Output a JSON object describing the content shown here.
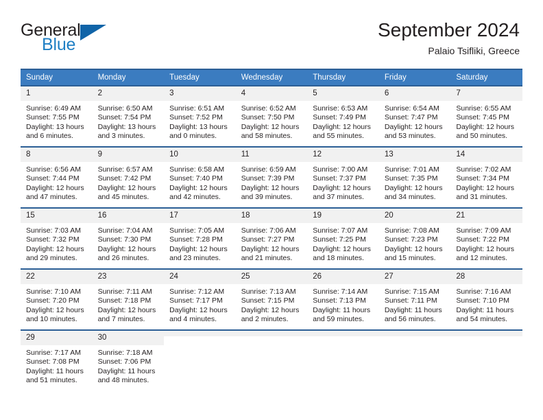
{
  "brand": {
    "word_one": "General",
    "word_two": "Blue",
    "logo_icon": "triangle-logo-icon"
  },
  "header": {
    "title": "September 2024",
    "subtitle": "Palaio Tsifliki, Greece"
  },
  "calendar": {
    "weekdays": [
      "Sunday",
      "Monday",
      "Tuesday",
      "Wednesday",
      "Thursday",
      "Friday",
      "Saturday"
    ],
    "accent_header_color": "#3b7cc0",
    "accent_border_color": "#2c5f96",
    "daynum_background": "#f1f1f1",
    "weeks": [
      [
        {
          "day": "1",
          "sunrise": "Sunrise: 6:49 AM",
          "sunset": "Sunset: 7:55 PM",
          "daylight": "Daylight: 13 hours and 6 minutes."
        },
        {
          "day": "2",
          "sunrise": "Sunrise: 6:50 AM",
          "sunset": "Sunset: 7:54 PM",
          "daylight": "Daylight: 13 hours and 3 minutes."
        },
        {
          "day": "3",
          "sunrise": "Sunrise: 6:51 AM",
          "sunset": "Sunset: 7:52 PM",
          "daylight": "Daylight: 13 hours and 0 minutes."
        },
        {
          "day": "4",
          "sunrise": "Sunrise: 6:52 AM",
          "sunset": "Sunset: 7:50 PM",
          "daylight": "Daylight: 12 hours and 58 minutes."
        },
        {
          "day": "5",
          "sunrise": "Sunrise: 6:53 AM",
          "sunset": "Sunset: 7:49 PM",
          "daylight": "Daylight: 12 hours and 55 minutes."
        },
        {
          "day": "6",
          "sunrise": "Sunrise: 6:54 AM",
          "sunset": "Sunset: 7:47 PM",
          "daylight": "Daylight: 12 hours and 53 minutes."
        },
        {
          "day": "7",
          "sunrise": "Sunrise: 6:55 AM",
          "sunset": "Sunset: 7:45 PM",
          "daylight": "Daylight: 12 hours and 50 minutes."
        }
      ],
      [
        {
          "day": "8",
          "sunrise": "Sunrise: 6:56 AM",
          "sunset": "Sunset: 7:44 PM",
          "daylight": "Daylight: 12 hours and 47 minutes."
        },
        {
          "day": "9",
          "sunrise": "Sunrise: 6:57 AM",
          "sunset": "Sunset: 7:42 PM",
          "daylight": "Daylight: 12 hours and 45 minutes."
        },
        {
          "day": "10",
          "sunrise": "Sunrise: 6:58 AM",
          "sunset": "Sunset: 7:40 PM",
          "daylight": "Daylight: 12 hours and 42 minutes."
        },
        {
          "day": "11",
          "sunrise": "Sunrise: 6:59 AM",
          "sunset": "Sunset: 7:39 PM",
          "daylight": "Daylight: 12 hours and 39 minutes."
        },
        {
          "day": "12",
          "sunrise": "Sunrise: 7:00 AM",
          "sunset": "Sunset: 7:37 PM",
          "daylight": "Daylight: 12 hours and 37 minutes."
        },
        {
          "day": "13",
          "sunrise": "Sunrise: 7:01 AM",
          "sunset": "Sunset: 7:35 PM",
          "daylight": "Daylight: 12 hours and 34 minutes."
        },
        {
          "day": "14",
          "sunrise": "Sunrise: 7:02 AM",
          "sunset": "Sunset: 7:34 PM",
          "daylight": "Daylight: 12 hours and 31 minutes."
        }
      ],
      [
        {
          "day": "15",
          "sunrise": "Sunrise: 7:03 AM",
          "sunset": "Sunset: 7:32 PM",
          "daylight": "Daylight: 12 hours and 29 minutes."
        },
        {
          "day": "16",
          "sunrise": "Sunrise: 7:04 AM",
          "sunset": "Sunset: 7:30 PM",
          "daylight": "Daylight: 12 hours and 26 minutes."
        },
        {
          "day": "17",
          "sunrise": "Sunrise: 7:05 AM",
          "sunset": "Sunset: 7:28 PM",
          "daylight": "Daylight: 12 hours and 23 minutes."
        },
        {
          "day": "18",
          "sunrise": "Sunrise: 7:06 AM",
          "sunset": "Sunset: 7:27 PM",
          "daylight": "Daylight: 12 hours and 21 minutes."
        },
        {
          "day": "19",
          "sunrise": "Sunrise: 7:07 AM",
          "sunset": "Sunset: 7:25 PM",
          "daylight": "Daylight: 12 hours and 18 minutes."
        },
        {
          "day": "20",
          "sunrise": "Sunrise: 7:08 AM",
          "sunset": "Sunset: 7:23 PM",
          "daylight": "Daylight: 12 hours and 15 minutes."
        },
        {
          "day": "21",
          "sunrise": "Sunrise: 7:09 AM",
          "sunset": "Sunset: 7:22 PM",
          "daylight": "Daylight: 12 hours and 12 minutes."
        }
      ],
      [
        {
          "day": "22",
          "sunrise": "Sunrise: 7:10 AM",
          "sunset": "Sunset: 7:20 PM",
          "daylight": "Daylight: 12 hours and 10 minutes."
        },
        {
          "day": "23",
          "sunrise": "Sunrise: 7:11 AM",
          "sunset": "Sunset: 7:18 PM",
          "daylight": "Daylight: 12 hours and 7 minutes."
        },
        {
          "day": "24",
          "sunrise": "Sunrise: 7:12 AM",
          "sunset": "Sunset: 7:17 PM",
          "daylight": "Daylight: 12 hours and 4 minutes."
        },
        {
          "day": "25",
          "sunrise": "Sunrise: 7:13 AM",
          "sunset": "Sunset: 7:15 PM",
          "daylight": "Daylight: 12 hours and 2 minutes."
        },
        {
          "day": "26",
          "sunrise": "Sunrise: 7:14 AM",
          "sunset": "Sunset: 7:13 PM",
          "daylight": "Daylight: 11 hours and 59 minutes."
        },
        {
          "day": "27",
          "sunrise": "Sunrise: 7:15 AM",
          "sunset": "Sunset: 7:11 PM",
          "daylight": "Daylight: 11 hours and 56 minutes."
        },
        {
          "day": "28",
          "sunrise": "Sunrise: 7:16 AM",
          "sunset": "Sunset: 7:10 PM",
          "daylight": "Daylight: 11 hours and 54 minutes."
        }
      ],
      [
        {
          "day": "29",
          "sunrise": "Sunrise: 7:17 AM",
          "sunset": "Sunset: 7:08 PM",
          "daylight": "Daylight: 11 hours and 51 minutes."
        },
        {
          "day": "30",
          "sunrise": "Sunrise: 7:18 AM",
          "sunset": "Sunset: 7:06 PM",
          "daylight": "Daylight: 11 hours and 48 minutes."
        },
        {
          "day": "",
          "sunrise": "",
          "sunset": "",
          "daylight": ""
        },
        {
          "day": "",
          "sunrise": "",
          "sunset": "",
          "daylight": ""
        },
        {
          "day": "",
          "sunrise": "",
          "sunset": "",
          "daylight": ""
        },
        {
          "day": "",
          "sunrise": "",
          "sunset": "",
          "daylight": ""
        },
        {
          "day": "",
          "sunrise": "",
          "sunset": "",
          "daylight": ""
        }
      ]
    ]
  }
}
